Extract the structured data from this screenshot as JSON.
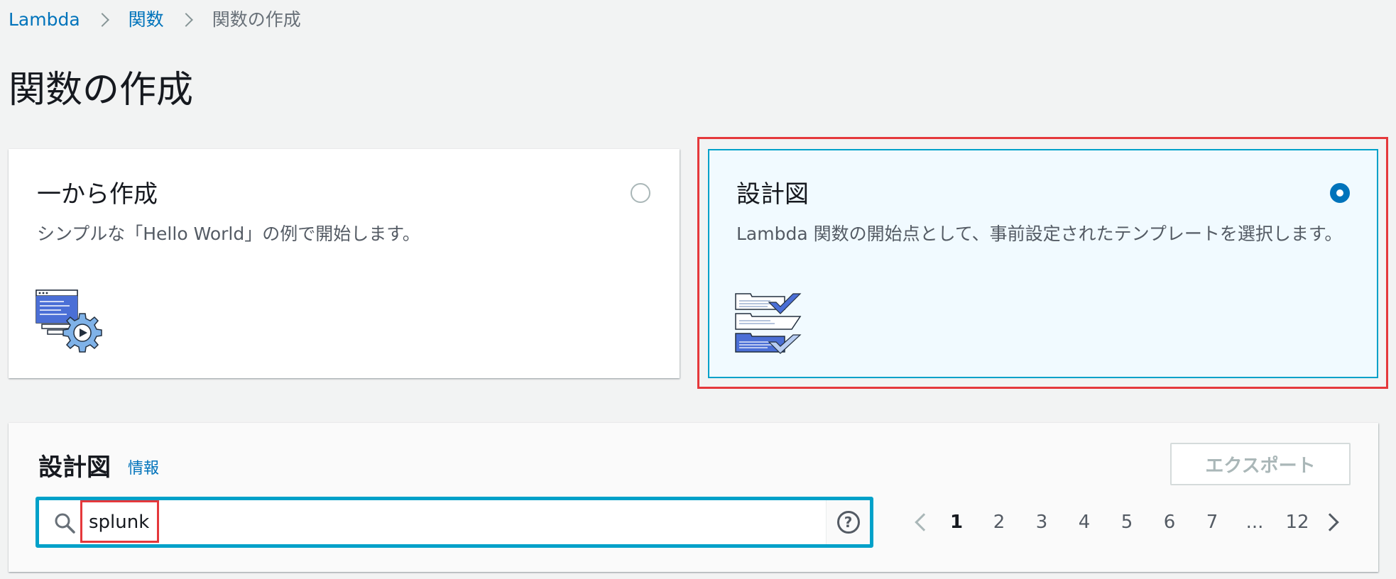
{
  "breadcrumb": {
    "items": [
      {
        "label": "Lambda"
      },
      {
        "label": "関数"
      },
      {
        "label": "関数の作成"
      }
    ]
  },
  "page_title": "関数の作成",
  "options": {
    "scratch": {
      "title": "一から作成",
      "description": "シンプルな「Hello World」の例で開始します。",
      "selected": false,
      "icon": "gear-window-icon"
    },
    "blueprint": {
      "title": "設計図",
      "description": "Lambda 関数の開始点として、事前設定されたテンプレートを選択します。",
      "selected": true,
      "icon": "template-checklist-icon"
    }
  },
  "blueprint_panel": {
    "title": "設計図",
    "info_link": "情報",
    "export_label": "エクスポート",
    "search": {
      "value": "splunk",
      "help_icon": "help-icon",
      "search_icon": "search-icon"
    },
    "pagination": {
      "pages": [
        "1",
        "2",
        "3",
        "4",
        "5",
        "6",
        "7"
      ],
      "ellipsis": "...",
      "last": "12",
      "current": "1"
    }
  },
  "colors": {
    "link": "#0073bb",
    "accent": "#00a1c9",
    "highlight": "#e5383b",
    "selected_card_bg": "#f1faff"
  }
}
